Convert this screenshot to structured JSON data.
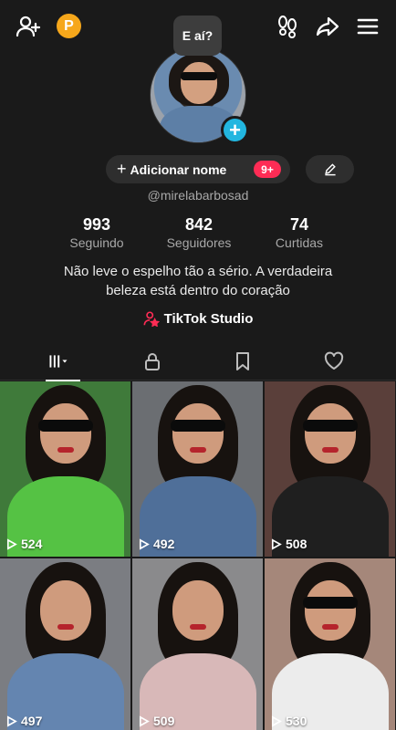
{
  "header": {
    "bubble_text": "E aí?",
    "points_badge": "P"
  },
  "profile": {
    "add_name_label": "Adicionar nome",
    "notif_count": "9+",
    "username": "@mirelabarbosad"
  },
  "stats": [
    {
      "value": "993",
      "label": "Seguindo"
    },
    {
      "value": "842",
      "label": "Seguidores"
    },
    {
      "value": "74",
      "label": "Curtidas"
    }
  ],
  "bio": {
    "line1": "Não leve o espelho tão a sério. A verdadeira",
    "line2": "beleza está dentro do coração"
  },
  "studio_label": "TikTok Studio",
  "colors": {
    "accent_red": "#fe2c55",
    "avatar_plus": "#22b6e0",
    "points_orange": "#f6a71b",
    "background": "#1a1a1a"
  },
  "videos": [
    {
      "views": "524",
      "bg": "#3f7a3a",
      "body": "#55c244"
    },
    {
      "views": "492",
      "bg": "#6b6e72",
      "body": "#4f6f99"
    },
    {
      "views": "508",
      "bg": "#5a3f3a",
      "body": "#1f1f1f"
    },
    {
      "views": "497",
      "bg": "#7b7d82",
      "body": "#6485b0"
    },
    {
      "views": "509",
      "bg": "#8a8a8c",
      "body": "#d8b8b8"
    },
    {
      "views": "530",
      "bg": "#a5877a",
      "body": "#ececec"
    }
  ]
}
